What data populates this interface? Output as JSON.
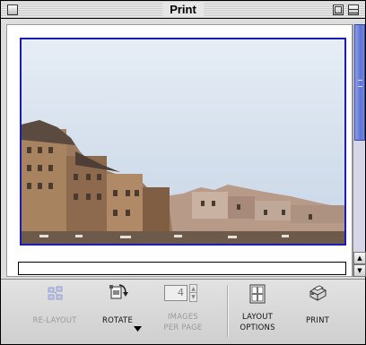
{
  "window": {
    "title": "Print"
  },
  "toolbar": {
    "relayout": {
      "label": "RE-LAYOUT",
      "icon": "relayout-icon",
      "enabled": false
    },
    "rotate": {
      "label": "ROTATE",
      "icon": "rotate-icon",
      "enabled": true
    },
    "images_per_page": {
      "label_line1": "IMAGES",
      "label_line2": "PER PAGE",
      "value": "4",
      "enabled": false
    },
    "layout_options": {
      "label_line1": "LAYOUT",
      "label_line2": "OPTIONS",
      "icon": "layout-grid-icon",
      "enabled": true
    },
    "print": {
      "label": "PRINT",
      "icon": "printer-icon",
      "enabled": true
    }
  },
  "colors": {
    "preview_border": "#1c1cb4",
    "scrollbar_thumb": "#5c73d6"
  }
}
